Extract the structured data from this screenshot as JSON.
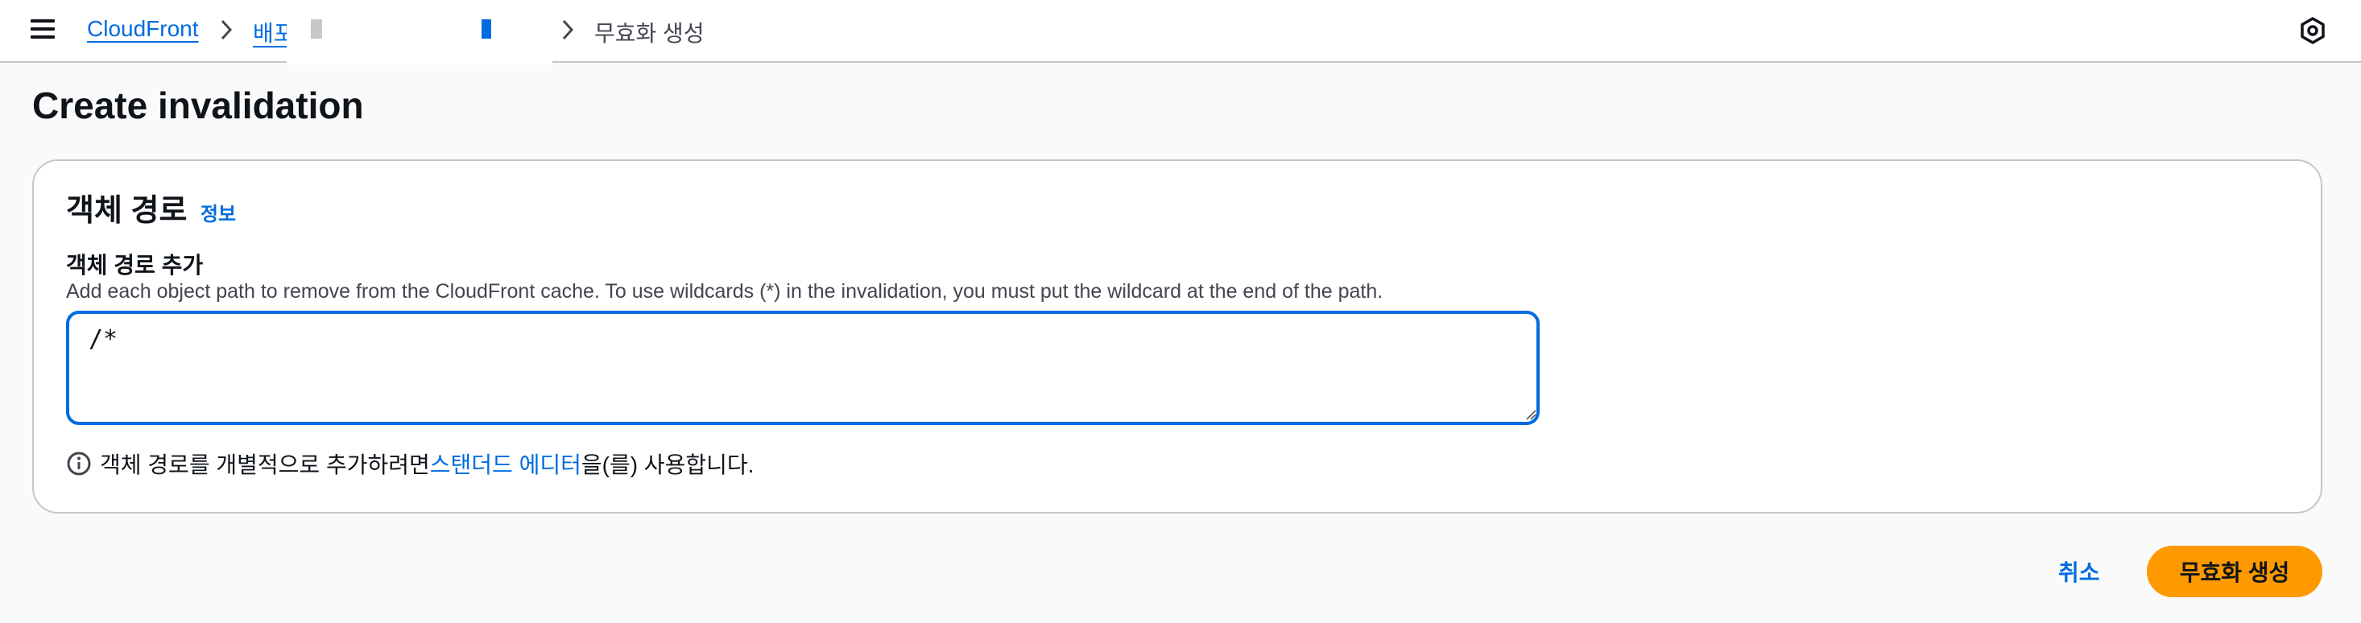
{
  "breadcrumb": {
    "service": "CloudFront",
    "distributions": "배포",
    "current": "무효화 생성"
  },
  "page": {
    "title": "Create invalidation"
  },
  "panel": {
    "title": "객체 경로",
    "info_label": "정보",
    "field_label": "객체 경로 추가",
    "field_description": "Add each object path to remove from the CloudFront cache. To use wildcards (*) in the invalidation, you must put the wildcard at the end of the path.",
    "path_value": "/*",
    "hint_prefix": "객체 경로를 개별적으로 추가하려면 ",
    "hint_link": "스탠더드 에디터",
    "hint_suffix": "을(를) 사용합니다."
  },
  "actions": {
    "cancel_label": "취소",
    "submit_label": "무효화 생성"
  },
  "colors": {
    "link": "#006ce0",
    "primary_button": "#ff9900",
    "border": "#c6c6cd",
    "redaction": "#c8c8c8"
  },
  "icons": {
    "menu": "hamburger-menu-icon",
    "chevron": "chevron-right-icon",
    "settings": "settings-icon",
    "info": "info-circle-icon"
  }
}
